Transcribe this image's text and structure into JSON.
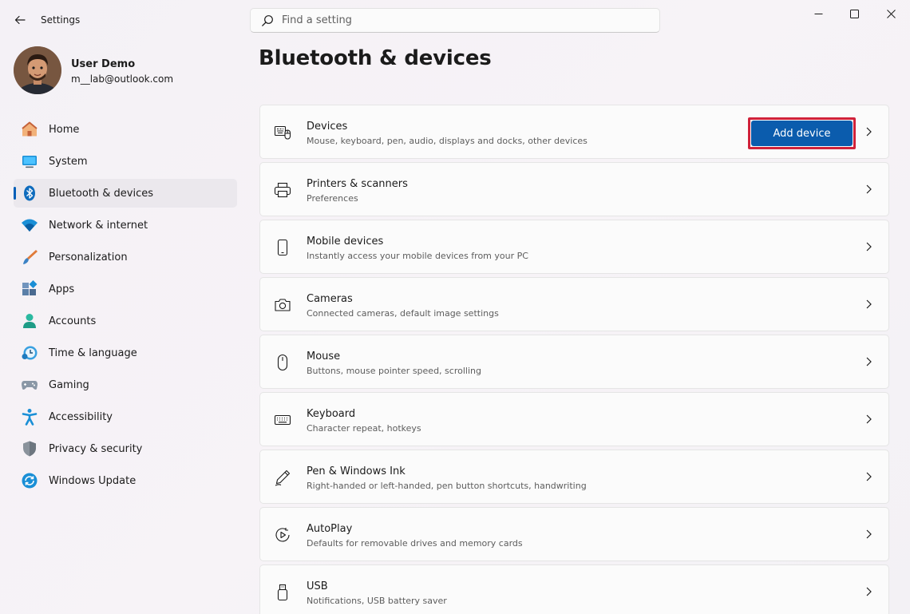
{
  "window": {
    "title": "Settings"
  },
  "search": {
    "placeholder": "Find a setting",
    "value": ""
  },
  "user": {
    "name": "User Demo",
    "email": "m__lab@outlook.com"
  },
  "nav": {
    "items": [
      {
        "label": "Home",
        "icon": "home-icon"
      },
      {
        "label": "System",
        "icon": "system-icon"
      },
      {
        "label": "Bluetooth & devices",
        "icon": "bluetooth-icon",
        "active": true
      },
      {
        "label": "Network & internet",
        "icon": "wifi-icon"
      },
      {
        "label": "Personalization",
        "icon": "brush-icon"
      },
      {
        "label": "Apps",
        "icon": "apps-icon"
      },
      {
        "label": "Accounts",
        "icon": "accounts-icon"
      },
      {
        "label": "Time & language",
        "icon": "clock-globe-icon"
      },
      {
        "label": "Gaming",
        "icon": "gamepad-icon"
      },
      {
        "label": "Accessibility",
        "icon": "accessibility-icon"
      },
      {
        "label": "Privacy & security",
        "icon": "shield-icon"
      },
      {
        "label": "Windows Update",
        "icon": "update-icon"
      }
    ]
  },
  "main": {
    "title": "Bluetooth & devices",
    "add_device_label": "Add device",
    "cards": [
      {
        "title": "Devices",
        "desc": "Mouse, keyboard, pen, audio, displays and docks, other devices",
        "icon": "devices-icon"
      },
      {
        "title": "Printers & scanners",
        "desc": "Preferences",
        "icon": "printer-icon"
      },
      {
        "title": "Mobile devices",
        "desc": "Instantly access your mobile devices from your PC",
        "icon": "phone-icon"
      },
      {
        "title": "Cameras",
        "desc": "Connected cameras, default image settings",
        "icon": "camera-icon"
      },
      {
        "title": "Mouse",
        "desc": "Buttons, mouse pointer speed, scrolling",
        "icon": "mouse-icon"
      },
      {
        "title": "Keyboard",
        "desc": "Character repeat, hotkeys",
        "icon": "keyboard-icon"
      },
      {
        "title": "Pen & Windows Ink",
        "desc": "Right-handed or left-handed, pen button shortcuts, handwriting",
        "icon": "pen-icon"
      },
      {
        "title": "AutoPlay",
        "desc": "Defaults for removable drives and memory cards",
        "icon": "autoplay-icon"
      },
      {
        "title": "USB",
        "desc": "Notifications, USB battery saver",
        "icon": "usb-icon"
      }
    ]
  },
  "colors": {
    "accent": "#005fb8",
    "button": "#0b5cad",
    "highlight_border": "#d0223a"
  }
}
